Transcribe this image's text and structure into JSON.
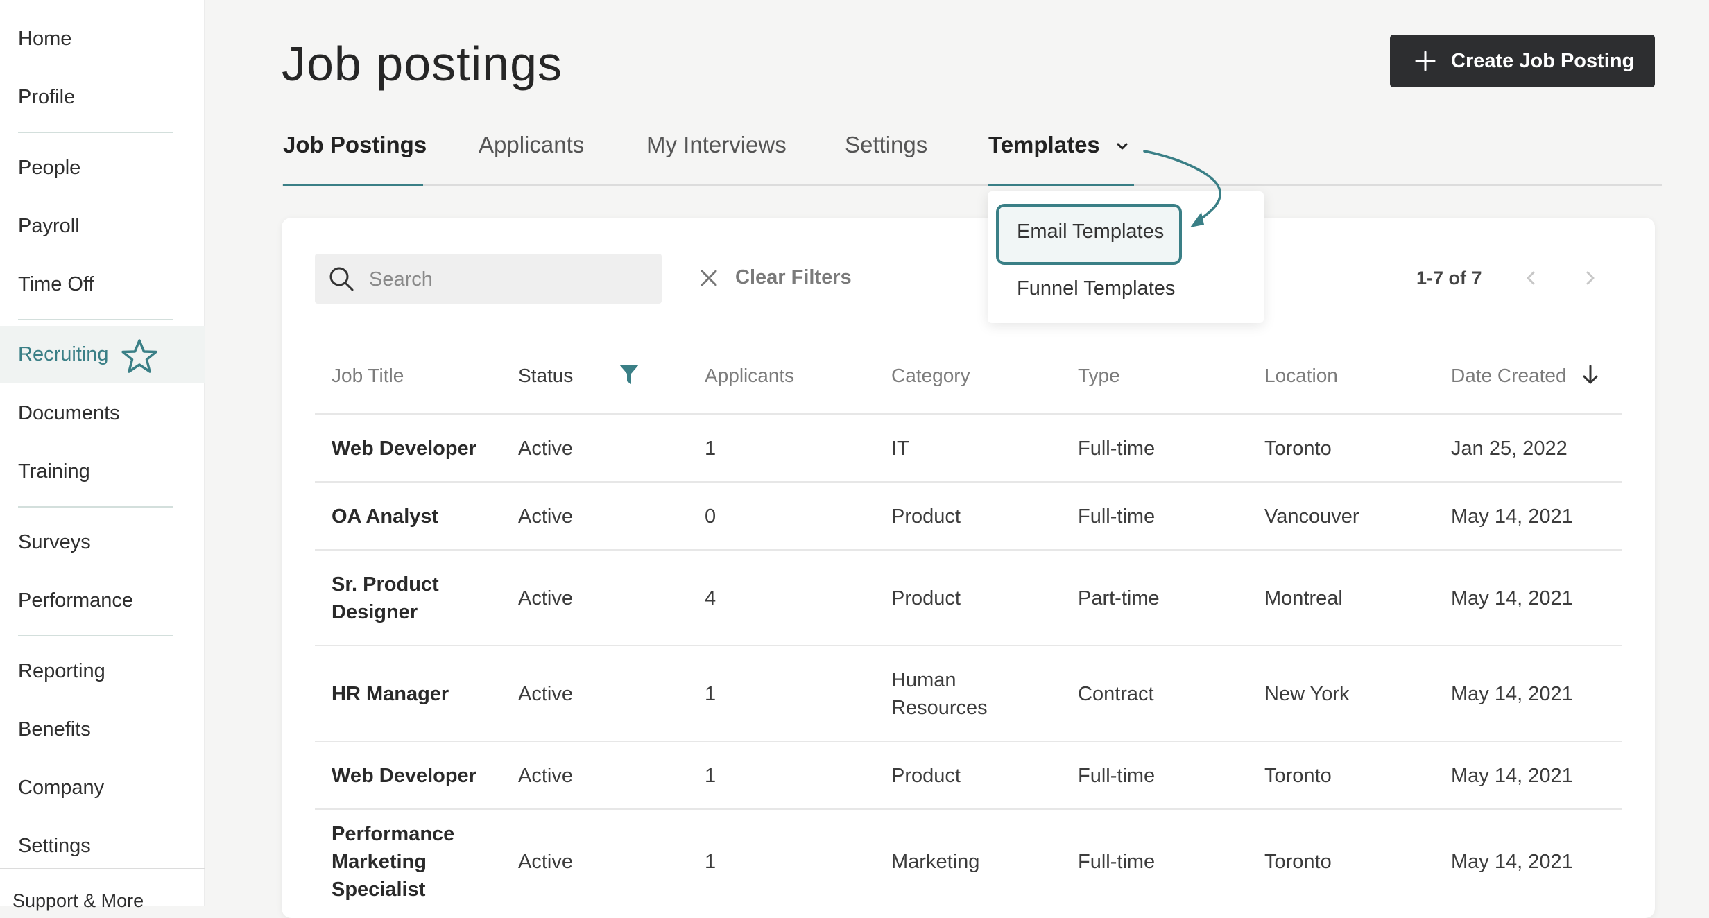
{
  "sidebar": {
    "items": [
      {
        "label": "Home"
      },
      {
        "label": "Profile"
      },
      {
        "label": "People"
      },
      {
        "label": "Payroll"
      },
      {
        "label": "Time Off"
      },
      {
        "label": "Recruiting"
      },
      {
        "label": "Documents"
      },
      {
        "label": "Training"
      },
      {
        "label": "Surveys"
      },
      {
        "label": "Performance"
      },
      {
        "label": "Reporting"
      },
      {
        "label": "Benefits"
      },
      {
        "label": "Company"
      },
      {
        "label": "Settings"
      }
    ],
    "active": "Recruiting",
    "active_icon": "star-icon",
    "support_label": "Support & More"
  },
  "header": {
    "title": "Job postings",
    "create_button": "Create Job Posting"
  },
  "tabs": [
    {
      "label": "Job Postings",
      "active": true
    },
    {
      "label": "Applicants"
    },
    {
      "label": "My Interviews"
    },
    {
      "label": "Settings"
    },
    {
      "label": "Templates"
    }
  ],
  "templates_menu": {
    "items": [
      {
        "label": "Email Templates",
        "highlighted": true
      },
      {
        "label": "Funnel Templates"
      }
    ]
  },
  "toolbar": {
    "search_placeholder": "Search",
    "clear_filters": "Clear Filters",
    "pagination": "1-7 of 7"
  },
  "table": {
    "columns": [
      "Job Title",
      "Status",
      "Applicants",
      "Category",
      "Type",
      "Location",
      "Date Created"
    ],
    "rows": [
      {
        "title": "Web Developer",
        "status": "Active",
        "applicants": "1",
        "category": "IT",
        "type": "Full-time",
        "location": "Toronto",
        "date": "Jan 25, 2022"
      },
      {
        "title": "OA Analyst",
        "status": "Active",
        "applicants": "0",
        "category": "Product",
        "type": "Full-time",
        "location": "Vancouver",
        "date": "May 14, 2021"
      },
      {
        "title": "Sr. Product\nDesigner",
        "status": "Active",
        "applicants": "4",
        "category": "Product",
        "type": "Part-time",
        "location": "Montreal",
        "date": "May 14, 2021"
      },
      {
        "title": "HR Manager",
        "status": "Active",
        "applicants": "1",
        "category": "Human\nResources",
        "type": "Contract",
        "location": "New York",
        "date": "May 14, 2021"
      },
      {
        "title": "Web Developer",
        "status": "Active",
        "applicants": "1",
        "category": "Product",
        "type": "Full-time",
        "location": "Toronto",
        "date": "May 14, 2021"
      },
      {
        "title": "Performance\nMarketing\nSpecialist",
        "status": "Active",
        "applicants": "1",
        "category": "Marketing",
        "type": "Full-time",
        "location": "Toronto",
        "date": "May 14, 2021"
      }
    ]
  },
  "colors": {
    "accent": "#3a7f86",
    "button_dark": "#2d2e30",
    "background": "#f5f5f4"
  }
}
